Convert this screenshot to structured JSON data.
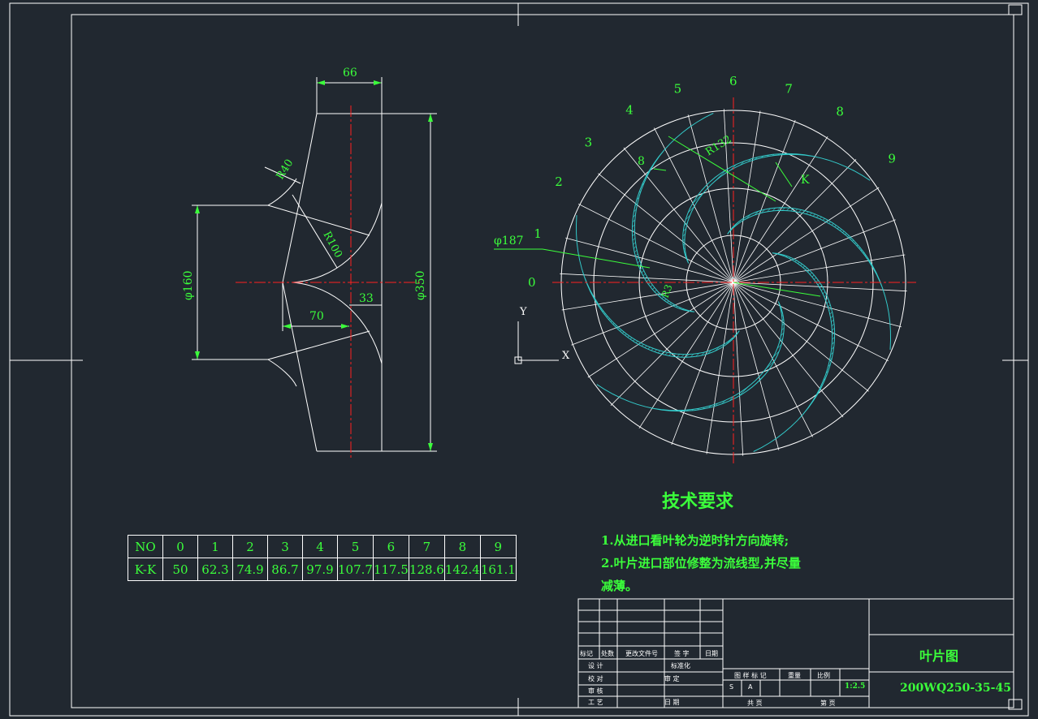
{
  "section_view": {
    "dim_width": "66",
    "dim_r40": "R40",
    "dim_r100": "R100",
    "dim_phi160": "φ160",
    "dim_phi350": "φ350",
    "dim_70": "70",
    "dim_33": "33"
  },
  "plan_view": {
    "radial_labels": [
      "0",
      "1",
      "2",
      "3",
      "4",
      "5",
      "6",
      "7",
      "8",
      "9"
    ],
    "dim_phi187": "φ187",
    "dim_r132": "R132",
    "dim_r3": "R3",
    "dim_8": "8",
    "section_mark": "K",
    "ucs_y": "Y",
    "ucs_x": "X"
  },
  "kk_table": {
    "headers": [
      "NO",
      "0",
      "1",
      "2",
      "3",
      "4",
      "5",
      "6",
      "7",
      "8",
      "9"
    ],
    "row_label": "K-K",
    "values": [
      "50",
      "62.3",
      "74.9",
      "86.7",
      "97.9",
      "107.7",
      "117.5",
      "128.6",
      "142.4",
      "161.1"
    ]
  },
  "tech_requirements": {
    "title": "技术要求",
    "line1": "1.从进口看叶轮为逆时针方向旋转;",
    "line2": "2.叶片进口部位修整为流线型,并尽量",
    "line3": "减薄。"
  },
  "title_block": {
    "drawing_name": "叶片图",
    "drawing_code": "200WQ250-35-45",
    "scale": "1:2.5",
    "row_labels": [
      "标记",
      "处数",
      "更改文件号",
      "签 字",
      "日期"
    ],
    "design": "设 计",
    "standardize": "标准化",
    "check": "校 对",
    "review": "审 定",
    "audit": "审 核",
    "process": "工 艺",
    "date": "日 期",
    "stage_mark": "图 样 标 记",
    "weight": "重量",
    "scale_label": "比例",
    "stage_s": "S",
    "stage_a": "A",
    "total_sheets": "共 页",
    "sheet_no": "第 页"
  }
}
